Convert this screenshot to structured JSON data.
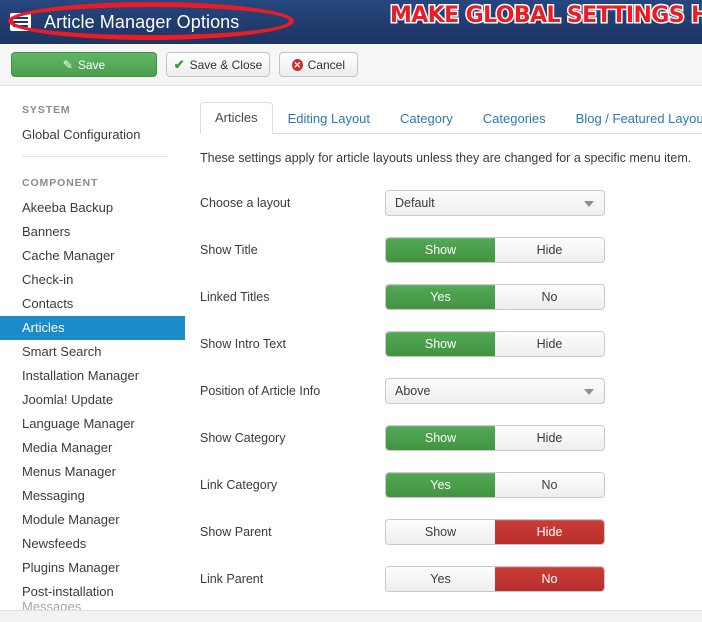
{
  "header": {
    "icon": "article-document-icon",
    "title": "Article Manager Options",
    "annotation": "MAKE GLOBAL SETTINGS HERE",
    "bar_color": "#1f3a69",
    "annotation_color": "#ed1c24"
  },
  "toolbar": {
    "save_label": "Save",
    "save_close_label": "Save & Close",
    "cancel_label": "Cancel",
    "save_icon": "pencil-square-icon",
    "save_close_icon": "check-icon",
    "cancel_icon": "circle-x-icon",
    "save_color": "#4a9e4d"
  },
  "sidebar": {
    "groups": [
      {
        "heading": "SYSTEM",
        "items": [
          {
            "label": "Global Configuration",
            "active": false,
            "dim": false
          }
        ]
      },
      {
        "heading": "COMPONENT",
        "items": [
          {
            "label": "Akeeba Backup",
            "active": false,
            "dim": false
          },
          {
            "label": "Banners",
            "active": false,
            "dim": false
          },
          {
            "label": "Cache Manager",
            "active": false,
            "dim": false
          },
          {
            "label": "Check-in",
            "active": false,
            "dim": false
          },
          {
            "label": "Contacts",
            "active": false,
            "dim": false
          },
          {
            "label": "Articles",
            "active": true,
            "dim": false
          },
          {
            "label": "Smart Search",
            "active": false,
            "dim": false
          },
          {
            "label": "Installation Manager",
            "active": false,
            "dim": false
          },
          {
            "label": "Joomla! Update",
            "active": false,
            "dim": false
          },
          {
            "label": "Language Manager",
            "active": false,
            "dim": false
          },
          {
            "label": "Media Manager",
            "active": false,
            "dim": false
          },
          {
            "label": "Menus Manager",
            "active": false,
            "dim": false
          },
          {
            "label": "Messaging",
            "active": false,
            "dim": false
          },
          {
            "label": "Module Manager",
            "active": false,
            "dim": false
          },
          {
            "label": "Newsfeeds",
            "active": false,
            "dim": false
          },
          {
            "label": "Plugins Manager",
            "active": false,
            "dim": false
          },
          {
            "label": "Post-installation",
            "active": false,
            "dim": false
          },
          {
            "label": "Messages",
            "active": false,
            "dim": true
          }
        ]
      }
    ],
    "active_color": "#1b8bc9"
  },
  "content": {
    "tabs": [
      {
        "label": "Articles",
        "active": true
      },
      {
        "label": "Editing Layout",
        "active": false
      },
      {
        "label": "Category",
        "active": false
      },
      {
        "label": "Categories",
        "active": false
      },
      {
        "label": "Blog / Featured Layouts",
        "active": false
      }
    ],
    "intro": "These settings apply for article layouts unless they are changed for a specific menu item.",
    "fields": [
      {
        "label": "Choose a layout",
        "type": "select",
        "value": "Default"
      },
      {
        "label": "Show Title",
        "type": "toggle",
        "options": [
          "Show",
          "Hide"
        ],
        "selected": "Show",
        "state": "green"
      },
      {
        "label": "Linked Titles",
        "type": "toggle",
        "options": [
          "Yes",
          "No"
        ],
        "selected": "Yes",
        "state": "green"
      },
      {
        "label": "Show Intro Text",
        "type": "toggle",
        "options": [
          "Show",
          "Hide"
        ],
        "selected": "Show",
        "state": "green"
      },
      {
        "label": "Position of Article Info",
        "type": "select",
        "value": "Above"
      },
      {
        "label": "Show Category",
        "type": "toggle",
        "options": [
          "Show",
          "Hide"
        ],
        "selected": "Show",
        "state": "green"
      },
      {
        "label": "Link Category",
        "type": "toggle",
        "options": [
          "Yes",
          "No"
        ],
        "selected": "Yes",
        "state": "green"
      },
      {
        "label": "Show Parent",
        "type": "toggle",
        "options": [
          "Show",
          "Hide"
        ],
        "selected": "Hide",
        "state": "red"
      },
      {
        "label": "Link Parent",
        "type": "toggle",
        "options": [
          "Yes",
          "No"
        ],
        "selected": "No",
        "state": "red"
      }
    ]
  }
}
